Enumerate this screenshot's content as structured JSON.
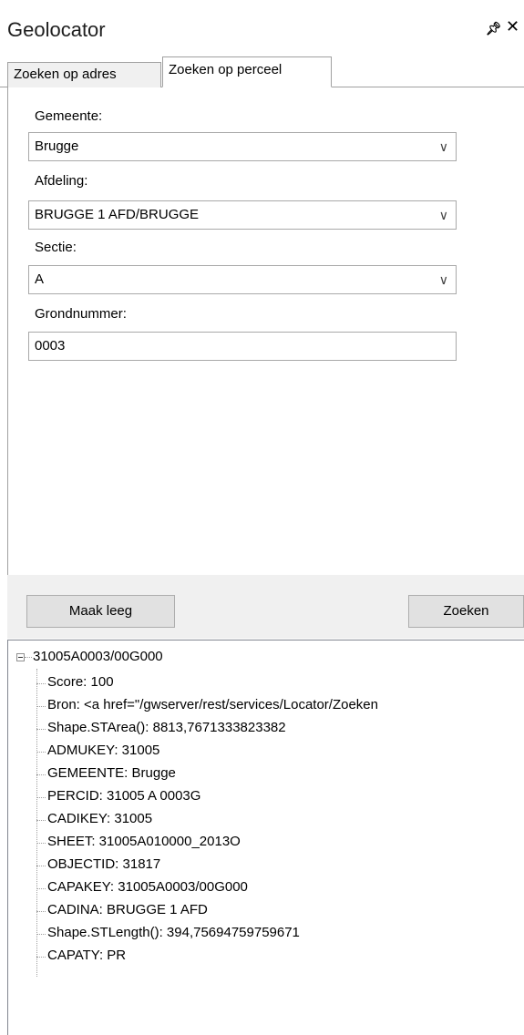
{
  "window": {
    "title": "Geolocator",
    "pin_icon": "pin-icon",
    "close_icon": "close-icon"
  },
  "tabs": [
    {
      "label": "Zoeken op adres",
      "active": false
    },
    {
      "label": "Zoeken op perceel",
      "active": true
    }
  ],
  "form": {
    "gemeente_label": "Gemeente:",
    "gemeente_value": "Brugge",
    "afdeling_label": "Afdeling:",
    "afdeling_value": "BRUGGE 1 AFD/BRUGGE",
    "sectie_label": "Sectie:",
    "sectie_value": "A",
    "grondnummer_label": "Grondnummer:",
    "grondnummer_value": "0003"
  },
  "buttons": {
    "clear_label": "Maak leeg",
    "search_label": "Zoeken"
  },
  "results": {
    "root": "31005A0003/00G000",
    "items": [
      "Score: 100",
      "Bron: <a href=\"/gwserver/rest/services/Locator/Zoeken",
      "Shape.STArea(): 8813,7671333823382",
      "ADMUKEY: 31005",
      "GEMEENTE: Brugge",
      "PERCID: 31005 A 0003G",
      "CADIKEY: 31005",
      "SHEET: 31005A010000_2013O",
      "OBJECTID: 31817",
      "CAPAKEY: 31005A0003/00G000",
      "CADINA: BRUGGE  1 AFD",
      "Shape.STLength(): 394,75694759759671",
      "CAPATY: PR"
    ]
  }
}
